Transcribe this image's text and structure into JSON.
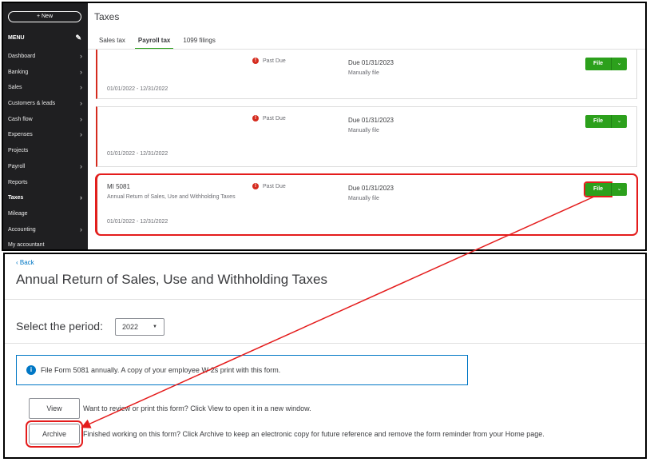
{
  "sidebar": {
    "new_label": "+ New",
    "menu_label": "MENU",
    "items": [
      {
        "label": "Dashboard",
        "chevron": true
      },
      {
        "label": "Banking",
        "chevron": true
      },
      {
        "label": "Sales",
        "chevron": true
      },
      {
        "label": "Customers & leads",
        "chevron": true
      },
      {
        "label": "Cash flow",
        "chevron": true
      },
      {
        "label": "Expenses",
        "chevron": true
      },
      {
        "label": "Projects",
        "chevron": false
      },
      {
        "label": "Payroll",
        "chevron": true
      },
      {
        "label": "Reports",
        "chevron": false
      },
      {
        "label": "Taxes",
        "chevron": true,
        "active": true
      },
      {
        "label": "Mileage",
        "chevron": false
      },
      {
        "label": "Accounting",
        "chevron": true
      },
      {
        "label": "My accountant",
        "chevron": false
      }
    ]
  },
  "taxes": {
    "title": "Taxes",
    "tabs": [
      {
        "label": "Sales tax"
      },
      {
        "label": "Payroll tax",
        "active": true
      },
      {
        "label": "1099 filings"
      }
    ],
    "cards": [
      {
        "name": "",
        "desc": "",
        "period": "01/01/2022 - 12/31/2022",
        "status": "Past Due",
        "due": "Due 01/31/2023",
        "method": "Manually file",
        "file_label": "File",
        "highlight": false
      },
      {
        "name": "",
        "desc": "",
        "period": "01/01/2022 - 12/31/2022",
        "status": "Past Due",
        "due": "Due 01/31/2023",
        "method": "Manually file",
        "file_label": "File",
        "highlight": false
      },
      {
        "name": "MI 5081",
        "desc": "Annual Return of Sales, Use and Withholding Taxes",
        "period": "01/01/2022 - 12/31/2022",
        "status": "Past Due",
        "due": "Due 01/31/2023",
        "method": "Manually file",
        "file_label": "File",
        "highlight": true
      }
    ]
  },
  "form": {
    "back_label": "Back",
    "title": "Annual Return of Sales, Use and Withholding Taxes",
    "period_label": "Select the period:",
    "period_value": "2022",
    "info_text": "File Form 5081 annually. A copy of your employee W-2s print with this form.",
    "view_label": "View",
    "view_desc": "Want to review or print this form? Click View to open it in a new window.",
    "archive_label": "Archive",
    "archive_desc": "Finished working on this form? Click Archive to keep an electronic copy for future reference and remove the form reminder from your Home page."
  },
  "colors": {
    "accent_green": "#2ca01c",
    "alert_red": "#d52b1e",
    "highlight_red": "#e41c1c",
    "link_blue": "#0077c5",
    "sidebar_bg": "#1f1f21"
  },
  "icons": {
    "back": "chevron-left-icon",
    "info": "info-icon",
    "status": "alert-icon",
    "dropdown": "chevron-down-icon",
    "edit": "pencil-icon"
  }
}
